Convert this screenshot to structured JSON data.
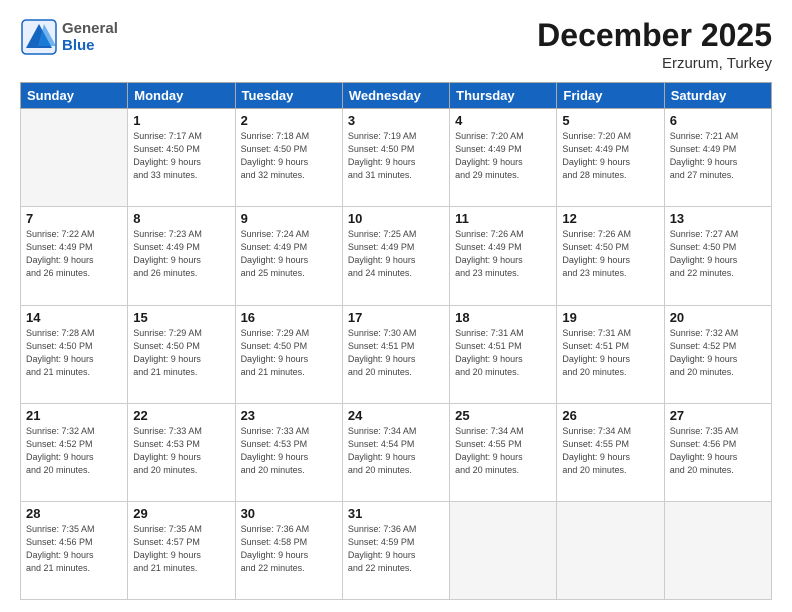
{
  "header": {
    "logo_general": "General",
    "logo_blue": "Blue",
    "month_title": "December 2025",
    "location": "Erzurum, Turkey"
  },
  "weekdays": [
    "Sunday",
    "Monday",
    "Tuesday",
    "Wednesday",
    "Thursday",
    "Friday",
    "Saturday"
  ],
  "weeks": [
    [
      {
        "day": "",
        "info": ""
      },
      {
        "day": "1",
        "info": "Sunrise: 7:17 AM\nSunset: 4:50 PM\nDaylight: 9 hours\nand 33 minutes."
      },
      {
        "day": "2",
        "info": "Sunrise: 7:18 AM\nSunset: 4:50 PM\nDaylight: 9 hours\nand 32 minutes."
      },
      {
        "day": "3",
        "info": "Sunrise: 7:19 AM\nSunset: 4:50 PM\nDaylight: 9 hours\nand 31 minutes."
      },
      {
        "day": "4",
        "info": "Sunrise: 7:20 AM\nSunset: 4:49 PM\nDaylight: 9 hours\nand 29 minutes."
      },
      {
        "day": "5",
        "info": "Sunrise: 7:20 AM\nSunset: 4:49 PM\nDaylight: 9 hours\nand 28 minutes."
      },
      {
        "day": "6",
        "info": "Sunrise: 7:21 AM\nSunset: 4:49 PM\nDaylight: 9 hours\nand 27 minutes."
      }
    ],
    [
      {
        "day": "7",
        "info": "Sunrise: 7:22 AM\nSunset: 4:49 PM\nDaylight: 9 hours\nand 26 minutes."
      },
      {
        "day": "8",
        "info": "Sunrise: 7:23 AM\nSunset: 4:49 PM\nDaylight: 9 hours\nand 26 minutes."
      },
      {
        "day": "9",
        "info": "Sunrise: 7:24 AM\nSunset: 4:49 PM\nDaylight: 9 hours\nand 25 minutes."
      },
      {
        "day": "10",
        "info": "Sunrise: 7:25 AM\nSunset: 4:49 PM\nDaylight: 9 hours\nand 24 minutes."
      },
      {
        "day": "11",
        "info": "Sunrise: 7:26 AM\nSunset: 4:49 PM\nDaylight: 9 hours\nand 23 minutes."
      },
      {
        "day": "12",
        "info": "Sunrise: 7:26 AM\nSunset: 4:50 PM\nDaylight: 9 hours\nand 23 minutes."
      },
      {
        "day": "13",
        "info": "Sunrise: 7:27 AM\nSunset: 4:50 PM\nDaylight: 9 hours\nand 22 minutes."
      }
    ],
    [
      {
        "day": "14",
        "info": "Sunrise: 7:28 AM\nSunset: 4:50 PM\nDaylight: 9 hours\nand 21 minutes."
      },
      {
        "day": "15",
        "info": "Sunrise: 7:29 AM\nSunset: 4:50 PM\nDaylight: 9 hours\nand 21 minutes."
      },
      {
        "day": "16",
        "info": "Sunrise: 7:29 AM\nSunset: 4:50 PM\nDaylight: 9 hours\nand 21 minutes."
      },
      {
        "day": "17",
        "info": "Sunrise: 7:30 AM\nSunset: 4:51 PM\nDaylight: 9 hours\nand 20 minutes."
      },
      {
        "day": "18",
        "info": "Sunrise: 7:31 AM\nSunset: 4:51 PM\nDaylight: 9 hours\nand 20 minutes."
      },
      {
        "day": "19",
        "info": "Sunrise: 7:31 AM\nSunset: 4:51 PM\nDaylight: 9 hours\nand 20 minutes."
      },
      {
        "day": "20",
        "info": "Sunrise: 7:32 AM\nSunset: 4:52 PM\nDaylight: 9 hours\nand 20 minutes."
      }
    ],
    [
      {
        "day": "21",
        "info": "Sunrise: 7:32 AM\nSunset: 4:52 PM\nDaylight: 9 hours\nand 20 minutes."
      },
      {
        "day": "22",
        "info": "Sunrise: 7:33 AM\nSunset: 4:53 PM\nDaylight: 9 hours\nand 20 minutes."
      },
      {
        "day": "23",
        "info": "Sunrise: 7:33 AM\nSunset: 4:53 PM\nDaylight: 9 hours\nand 20 minutes."
      },
      {
        "day": "24",
        "info": "Sunrise: 7:34 AM\nSunset: 4:54 PM\nDaylight: 9 hours\nand 20 minutes."
      },
      {
        "day": "25",
        "info": "Sunrise: 7:34 AM\nSunset: 4:55 PM\nDaylight: 9 hours\nand 20 minutes."
      },
      {
        "day": "26",
        "info": "Sunrise: 7:34 AM\nSunset: 4:55 PM\nDaylight: 9 hours\nand 20 minutes."
      },
      {
        "day": "27",
        "info": "Sunrise: 7:35 AM\nSunset: 4:56 PM\nDaylight: 9 hours\nand 20 minutes."
      }
    ],
    [
      {
        "day": "28",
        "info": "Sunrise: 7:35 AM\nSunset: 4:56 PM\nDaylight: 9 hours\nand 21 minutes."
      },
      {
        "day": "29",
        "info": "Sunrise: 7:35 AM\nSunset: 4:57 PM\nDaylight: 9 hours\nand 21 minutes."
      },
      {
        "day": "30",
        "info": "Sunrise: 7:36 AM\nSunset: 4:58 PM\nDaylight: 9 hours\nand 22 minutes."
      },
      {
        "day": "31",
        "info": "Sunrise: 7:36 AM\nSunset: 4:59 PM\nDaylight: 9 hours\nand 22 minutes."
      },
      {
        "day": "",
        "info": ""
      },
      {
        "day": "",
        "info": ""
      },
      {
        "day": "",
        "info": ""
      }
    ]
  ]
}
